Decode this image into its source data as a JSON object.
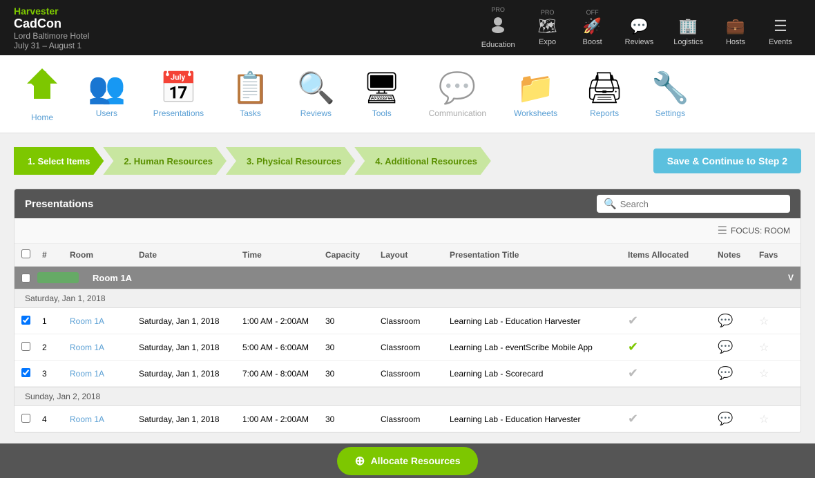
{
  "brand": {
    "logo_text": "Harvester",
    "title": "CadCon",
    "line1": "Lord Baltimore Hotel",
    "line2": "July 31 – August 1"
  },
  "top_nav": {
    "items": [
      {
        "label": "Education",
        "badge": "PRO",
        "icon": "👤",
        "name": "education"
      },
      {
        "label": "Expo",
        "badge": "PRO",
        "icon": "🗺",
        "name": "expo"
      },
      {
        "label": "Boost",
        "badge": "OFF",
        "icon": "🚀",
        "name": "boost"
      },
      {
        "label": "Reviews",
        "badge": "",
        "icon": "💬",
        "name": "reviews"
      },
      {
        "label": "Logistics",
        "badge": "",
        "icon": "🏢",
        "name": "logistics"
      },
      {
        "label": "Hosts",
        "badge": "",
        "icon": "💼",
        "name": "hosts"
      },
      {
        "label": "Events",
        "badge": "",
        "icon": "☰",
        "name": "events"
      }
    ]
  },
  "icon_nav": {
    "items": [
      {
        "label": "Home",
        "icon": "🏠",
        "color": "green",
        "name": "home"
      },
      {
        "label": "Users",
        "icon": "👥",
        "color": "blue",
        "name": "users"
      },
      {
        "label": "Presentations",
        "icon": "📅",
        "color": "blue",
        "name": "presentations"
      },
      {
        "label": "Tasks",
        "icon": "📋",
        "color": "blue",
        "name": "tasks"
      },
      {
        "label": "Reviews",
        "icon": "🔍",
        "color": "blue",
        "name": "reviews"
      },
      {
        "label": "Tools",
        "icon": "🖥",
        "color": "blue",
        "name": "tools"
      },
      {
        "label": "Communication",
        "icon": "💬",
        "color": "gray",
        "name": "communication"
      },
      {
        "label": "Worksheets",
        "icon": "📁",
        "color": "blue",
        "name": "worksheets"
      },
      {
        "label": "Reports",
        "icon": "🖨",
        "color": "blue",
        "name": "reports"
      },
      {
        "label": "Settings",
        "icon": "🔧",
        "color": "blue",
        "name": "settings"
      }
    ]
  },
  "steps": [
    {
      "label": "1. Select Items",
      "state": "active"
    },
    {
      "label": "2. Human Resources",
      "state": "inactive"
    },
    {
      "label": "3. Physical Resources",
      "state": "inactive"
    },
    {
      "label": "4. Additional Resources",
      "state": "inactive"
    }
  ],
  "save_btn_label": "Save & Continue to Step 2",
  "table": {
    "title": "Presentations",
    "search_placeholder": "Search",
    "focus_label": "FOCUS: ROOM",
    "columns": [
      "",
      "#",
      "Room",
      "Date",
      "Time",
      "Capacity",
      "Layout",
      "Presentation Title",
      "Items Allocated",
      "Notes",
      "Favs"
    ],
    "room_group": {
      "name": "Room 1A",
      "collapse": "V"
    },
    "date_groups": [
      {
        "date": "Saturday, Jan 1, 2018",
        "rows": [
          {
            "num": 1,
            "checked": true,
            "room": "Room 1A",
            "date": "Saturday, Jan 1, 2018",
            "time": "1:00 AM - 2:00AM",
            "capacity": 30,
            "layout": "Classroom",
            "title": "Learning Lab - Education Harvester",
            "allocated": "check-circle",
            "alloc_color": "gray",
            "notes": true,
            "fav": false
          },
          {
            "num": 2,
            "checked": false,
            "room": "Room 1A",
            "date": "Saturday, Jan 1, 2018",
            "time": "5:00 AM - 6:00AM",
            "capacity": 30,
            "layout": "Classroom",
            "title": "Learning Lab - eventScribe Mobile App",
            "allocated": "check-circle",
            "alloc_color": "green",
            "notes": true,
            "fav": false
          },
          {
            "num": 3,
            "checked": true,
            "room": "Room 1A",
            "date": "Saturday, Jan 1, 2018",
            "time": "7:00 AM - 8:00AM",
            "capacity": 30,
            "layout": "Classroom",
            "title": "Learning Lab - Scorecard",
            "allocated": "check-circle",
            "alloc_color": "gray",
            "notes": true,
            "fav": false
          }
        ]
      },
      {
        "date": "Sunday, Jan 2, 2018",
        "rows": [
          {
            "num": 4,
            "checked": false,
            "room": "Room 1A",
            "date": "Saturday, Jan 1, 2018",
            "time": "1:00 AM - 2:00AM",
            "capacity": 30,
            "layout": "Classroom",
            "title": "Learning Lab - Education Harvester",
            "allocated": "check-circle",
            "alloc_color": "gray",
            "notes": true,
            "fav": false
          }
        ]
      }
    ]
  },
  "allocate_btn_label": "Allocate Resources"
}
